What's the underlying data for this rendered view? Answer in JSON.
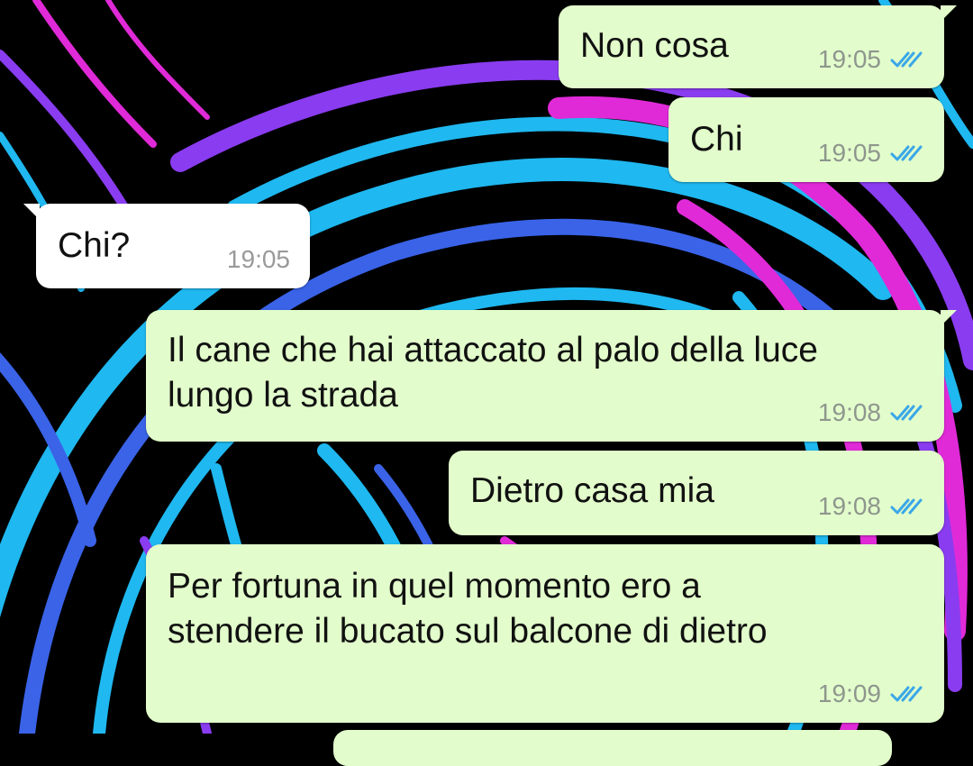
{
  "colors": {
    "outgoing_bubble": "#e2fdcb",
    "incoming_bubble": "#ffffff",
    "read_ticks": "#3aa7e8",
    "timestamp": "#8e968e",
    "wallpaper_base": "#000000",
    "wallpaper_cyan": "#1fb8f0",
    "wallpaper_blue": "#3a63e8",
    "wallpaper_purple": "#8a3cf0",
    "wallpaper_magenta": "#e02ad8"
  },
  "icons": {
    "read_status": "double-check-icon"
  },
  "messages": [
    {
      "direction": "outgoing",
      "text": "Non cosa",
      "time": "19:05",
      "status": "read"
    },
    {
      "direction": "outgoing",
      "text": "Chi",
      "time": "19:05",
      "status": "read"
    },
    {
      "direction": "incoming",
      "text": "Chi?",
      "time": "19:05"
    },
    {
      "direction": "outgoing",
      "text": "Il cane che hai attaccato al palo della luce\nlungo la strada",
      "time": "19:08",
      "status": "read"
    },
    {
      "direction": "outgoing",
      "text": "Dietro casa mia",
      "time": "19:08",
      "status": "read"
    },
    {
      "direction": "outgoing",
      "text": "Per fortuna in quel momento ero a\nstendere il bucato sul balcone di dietro",
      "time": "19:09",
      "status": "read"
    }
  ]
}
